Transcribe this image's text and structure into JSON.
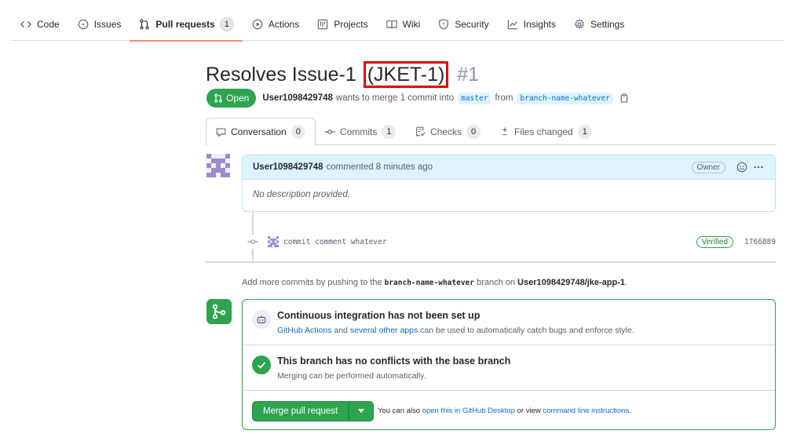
{
  "nav": {
    "items": [
      {
        "label": "Code",
        "icon": "code-icon"
      },
      {
        "label": "Issues",
        "icon": "issue-icon"
      },
      {
        "label": "Pull requests",
        "icon": "pull-request-icon",
        "count": "1",
        "active": true
      },
      {
        "label": "Actions",
        "icon": "play-icon"
      },
      {
        "label": "Projects",
        "icon": "project-icon"
      },
      {
        "label": "Wiki",
        "icon": "book-icon"
      },
      {
        "label": "Security",
        "icon": "shield-icon"
      },
      {
        "label": "Insights",
        "icon": "graph-icon"
      },
      {
        "label": "Settings",
        "icon": "gear-icon"
      }
    ]
  },
  "pr": {
    "title": "Resolves Issue-1",
    "issue_key": "(JKET-1)",
    "number": "#1",
    "state": "Open",
    "author": "User1098429748",
    "merge_text_1": "wants to merge 1 commit into",
    "base_branch": "master",
    "merge_text_2": "from",
    "head_branch": "branch-name-whatever"
  },
  "tabs": [
    {
      "label": "Conversation",
      "count": "0",
      "icon": "comment-icon"
    },
    {
      "label": "Commits",
      "count": "1",
      "icon": "commit-icon"
    },
    {
      "label": "Checks",
      "count": "0",
      "icon": "checklist-icon"
    },
    {
      "label": "Files changed",
      "count": "1",
      "icon": "diff-icon"
    }
  ],
  "comment": {
    "author": "User1098429748",
    "action": "commented 8 minutes ago",
    "role": "Owner",
    "body": "No description provided."
  },
  "commit": {
    "message": "commit comment whatever",
    "verified": "Verified",
    "sha": "1766889"
  },
  "add_more": {
    "prefix": "Add more commits by pushing to the",
    "branch": "branch-name-whatever",
    "middle": "branch on",
    "repo": "User1098429748/jke-app-1",
    "suffix": "."
  },
  "merge": {
    "ci_title": "Continuous integration has not been set up",
    "ci_link1": "GitHub Actions",
    "ci_and": "and",
    "ci_link2": "several other apps",
    "ci_rest": "can be used to automatically catch bugs and enforce style.",
    "conflict_title": "This branch has no conflicts with the base branch",
    "conflict_sub": "Merging can be performed automatically.",
    "button": "Merge pull request",
    "hint_prefix": "You can also",
    "hint_link1": "open this in GitHub Desktop",
    "hint_mid": "or view",
    "hint_link2": "command line instructions",
    "hint_suffix": "."
  },
  "colors": {
    "green": "#2da44e",
    "blue_link": "#0969da",
    "highlight_box": "#e00000",
    "nav_underline": "#fd8c73"
  }
}
